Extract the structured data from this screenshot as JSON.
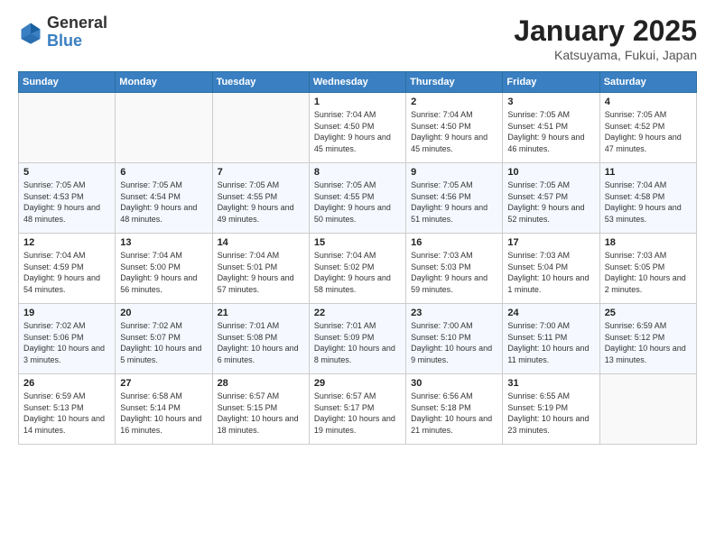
{
  "header": {
    "logo_general": "General",
    "logo_blue": "Blue",
    "title": "January 2025",
    "subtitle": "Katsuyama, Fukui, Japan"
  },
  "calendar": {
    "days_of_week": [
      "Sunday",
      "Monday",
      "Tuesday",
      "Wednesday",
      "Thursday",
      "Friday",
      "Saturday"
    ],
    "weeks": [
      [
        {
          "day": "",
          "info": ""
        },
        {
          "day": "",
          "info": ""
        },
        {
          "day": "",
          "info": ""
        },
        {
          "day": "1",
          "info": "Sunrise: 7:04 AM\nSunset: 4:50 PM\nDaylight: 9 hours and 45 minutes."
        },
        {
          "day": "2",
          "info": "Sunrise: 7:04 AM\nSunset: 4:50 PM\nDaylight: 9 hours and 45 minutes."
        },
        {
          "day": "3",
          "info": "Sunrise: 7:05 AM\nSunset: 4:51 PM\nDaylight: 9 hours and 46 minutes."
        },
        {
          "day": "4",
          "info": "Sunrise: 7:05 AM\nSunset: 4:52 PM\nDaylight: 9 hours and 47 minutes."
        }
      ],
      [
        {
          "day": "5",
          "info": "Sunrise: 7:05 AM\nSunset: 4:53 PM\nDaylight: 9 hours and 48 minutes."
        },
        {
          "day": "6",
          "info": "Sunrise: 7:05 AM\nSunset: 4:54 PM\nDaylight: 9 hours and 48 minutes."
        },
        {
          "day": "7",
          "info": "Sunrise: 7:05 AM\nSunset: 4:55 PM\nDaylight: 9 hours and 49 minutes."
        },
        {
          "day": "8",
          "info": "Sunrise: 7:05 AM\nSunset: 4:55 PM\nDaylight: 9 hours and 50 minutes."
        },
        {
          "day": "9",
          "info": "Sunrise: 7:05 AM\nSunset: 4:56 PM\nDaylight: 9 hours and 51 minutes."
        },
        {
          "day": "10",
          "info": "Sunrise: 7:05 AM\nSunset: 4:57 PM\nDaylight: 9 hours and 52 minutes."
        },
        {
          "day": "11",
          "info": "Sunrise: 7:04 AM\nSunset: 4:58 PM\nDaylight: 9 hours and 53 minutes."
        }
      ],
      [
        {
          "day": "12",
          "info": "Sunrise: 7:04 AM\nSunset: 4:59 PM\nDaylight: 9 hours and 54 minutes."
        },
        {
          "day": "13",
          "info": "Sunrise: 7:04 AM\nSunset: 5:00 PM\nDaylight: 9 hours and 56 minutes."
        },
        {
          "day": "14",
          "info": "Sunrise: 7:04 AM\nSunset: 5:01 PM\nDaylight: 9 hours and 57 minutes."
        },
        {
          "day": "15",
          "info": "Sunrise: 7:04 AM\nSunset: 5:02 PM\nDaylight: 9 hours and 58 minutes."
        },
        {
          "day": "16",
          "info": "Sunrise: 7:03 AM\nSunset: 5:03 PM\nDaylight: 9 hours and 59 minutes."
        },
        {
          "day": "17",
          "info": "Sunrise: 7:03 AM\nSunset: 5:04 PM\nDaylight: 10 hours and 1 minute."
        },
        {
          "day": "18",
          "info": "Sunrise: 7:03 AM\nSunset: 5:05 PM\nDaylight: 10 hours and 2 minutes."
        }
      ],
      [
        {
          "day": "19",
          "info": "Sunrise: 7:02 AM\nSunset: 5:06 PM\nDaylight: 10 hours and 3 minutes."
        },
        {
          "day": "20",
          "info": "Sunrise: 7:02 AM\nSunset: 5:07 PM\nDaylight: 10 hours and 5 minutes."
        },
        {
          "day": "21",
          "info": "Sunrise: 7:01 AM\nSunset: 5:08 PM\nDaylight: 10 hours and 6 minutes."
        },
        {
          "day": "22",
          "info": "Sunrise: 7:01 AM\nSunset: 5:09 PM\nDaylight: 10 hours and 8 minutes."
        },
        {
          "day": "23",
          "info": "Sunrise: 7:00 AM\nSunset: 5:10 PM\nDaylight: 10 hours and 9 minutes."
        },
        {
          "day": "24",
          "info": "Sunrise: 7:00 AM\nSunset: 5:11 PM\nDaylight: 10 hours and 11 minutes."
        },
        {
          "day": "25",
          "info": "Sunrise: 6:59 AM\nSunset: 5:12 PM\nDaylight: 10 hours and 13 minutes."
        }
      ],
      [
        {
          "day": "26",
          "info": "Sunrise: 6:59 AM\nSunset: 5:13 PM\nDaylight: 10 hours and 14 minutes."
        },
        {
          "day": "27",
          "info": "Sunrise: 6:58 AM\nSunset: 5:14 PM\nDaylight: 10 hours and 16 minutes."
        },
        {
          "day": "28",
          "info": "Sunrise: 6:57 AM\nSunset: 5:15 PM\nDaylight: 10 hours and 18 minutes."
        },
        {
          "day": "29",
          "info": "Sunrise: 6:57 AM\nSunset: 5:17 PM\nDaylight: 10 hours and 19 minutes."
        },
        {
          "day": "30",
          "info": "Sunrise: 6:56 AM\nSunset: 5:18 PM\nDaylight: 10 hours and 21 minutes."
        },
        {
          "day": "31",
          "info": "Sunrise: 6:55 AM\nSunset: 5:19 PM\nDaylight: 10 hours and 23 minutes."
        },
        {
          "day": "",
          "info": ""
        }
      ]
    ]
  }
}
